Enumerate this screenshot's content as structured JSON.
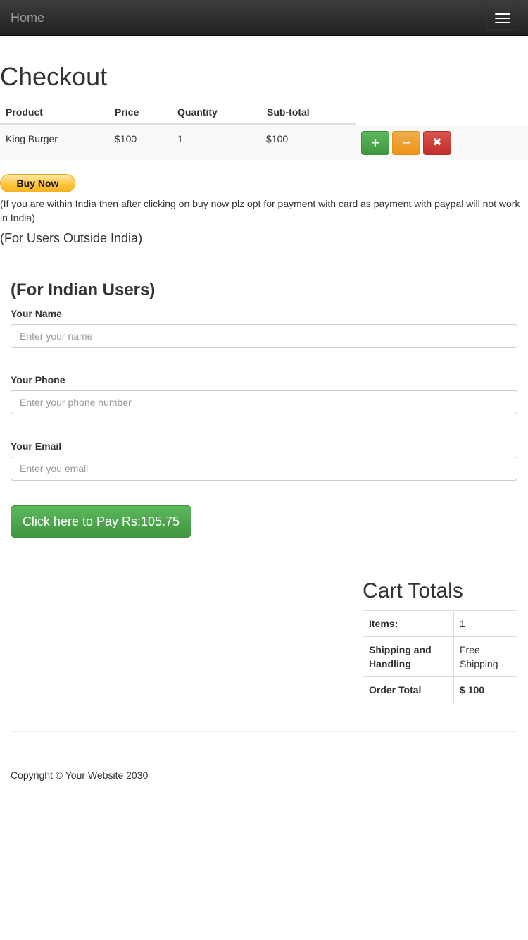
{
  "navbar": {
    "brand": "Home",
    "toggle_icon": "hamburger-icon"
  },
  "page": {
    "title": "Checkout"
  },
  "cart": {
    "headers": [
      "Product",
      "Price",
      "Quantity",
      "Sub-total"
    ],
    "rows": [
      {
        "product": "King Burger",
        "price": "$100",
        "quantity": "1",
        "subtotal": "$100"
      }
    ],
    "actions": {
      "plus": "+",
      "minus": "−",
      "remove": "✖"
    },
    "colors": {
      "plus": "#5cb85c",
      "minus": "#f0ad4e",
      "remove": "#d9534f"
    }
  },
  "paypal": {
    "button_label": "Buy Now",
    "note": "(If you are within India then after clicking on buy now plz opt for payment with card as payment with paypal will not work in India)",
    "outside_label": "(For Users Outside India)"
  },
  "indian_form": {
    "title": "(For Indian Users)",
    "name_label": "Your Name",
    "name_placeholder": "Enter your name",
    "phone_label": "Your Phone",
    "phone_placeholder": "Enter your phone number",
    "email_label": "Your Email",
    "email_placeholder": "Enter you email",
    "pay_button": "Click here to Pay Rs:105.75"
  },
  "cart_totals": {
    "title": "Cart Totals",
    "rows": [
      {
        "key": "Items:",
        "value": "1"
      },
      {
        "key": "Shipping and Handling",
        "value": "Free Shipping"
      },
      {
        "key": "Order Total",
        "value": "$ 100"
      }
    ]
  },
  "footer": {
    "copyright": "Copyright © Your Website 2030"
  }
}
